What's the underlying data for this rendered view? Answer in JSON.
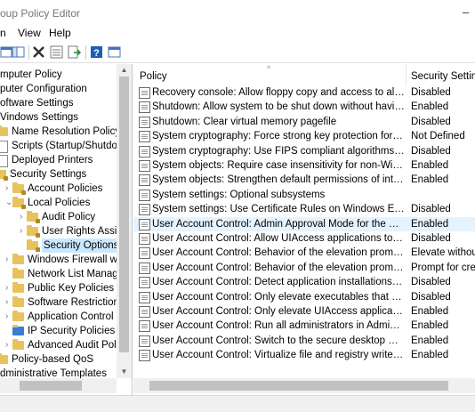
{
  "window": {
    "title": "oup Policy Editor",
    "minimize_glyph": "–"
  },
  "menubar": {
    "items": [
      {
        "label": "n"
      },
      {
        "label": "View"
      },
      {
        "label": "Help"
      }
    ]
  },
  "toolbar": {
    "icons": [
      "back-icon",
      "show-hide-tree-icon",
      "delete-icon",
      "properties-icon",
      "export-icon",
      "help-icon",
      "view-icon"
    ]
  },
  "tree": {
    "items": [
      {
        "label": "mputer Policy",
        "icon": "none",
        "indent": 0
      },
      {
        "label": "puter Configuration",
        "icon": "none",
        "indent": 0
      },
      {
        "label": "oftware Settings",
        "icon": "none",
        "indent": 0
      },
      {
        "label": "Vindows Settings",
        "icon": "none",
        "indent": 0
      },
      {
        "label": "Name Resolution Policy",
        "icon": "folder",
        "indent": 0
      },
      {
        "label": "Scripts (Startup/Shutdown",
        "icon": "doc",
        "indent": 0
      },
      {
        "label": "Deployed Printers",
        "icon": "doc",
        "indent": 0
      },
      {
        "label": "Security Settings",
        "icon": "folder-lock",
        "indent": 0
      },
      {
        "label": "Account Policies",
        "icon": "folder-lock",
        "indent": 1
      },
      {
        "label": "Local Policies",
        "icon": "folder-lock",
        "indent": 1
      },
      {
        "label": "Audit Policy",
        "icon": "folder-lock",
        "indent": 2
      },
      {
        "label": "User Rights Assignr",
        "icon": "folder-lock",
        "indent": 2
      },
      {
        "label": "Security Options",
        "icon": "folder-lock",
        "indent": 2,
        "selected": true
      },
      {
        "label": "Windows Firewall with",
        "icon": "folder",
        "indent": 1
      },
      {
        "label": "Network List Manager I",
        "icon": "folder",
        "indent": 1
      },
      {
        "label": "Public Key Policies",
        "icon": "folder",
        "indent": 1
      },
      {
        "label": "Software Restriction Po",
        "icon": "folder",
        "indent": 1
      },
      {
        "label": "Application Control Po",
        "icon": "folder",
        "indent": 1
      },
      {
        "label": "IP Security Policies on L",
        "icon": "folder",
        "indent": 1
      },
      {
        "label": "Advanced Audit Policy",
        "icon": "folder",
        "indent": 1
      },
      {
        "label": "Policy-based QoS",
        "icon": "folder",
        "indent": 0
      },
      {
        "label": "dministrative Templates",
        "icon": "none",
        "indent": 0
      }
    ]
  },
  "list": {
    "columns": {
      "policy": "Policy",
      "setting": "Security Setting"
    },
    "rows": [
      {
        "policy": "Recovery console: Allow floppy copy and access to all drives...",
        "setting": "Disabled"
      },
      {
        "policy": "Shutdown: Allow system to be shut down without having to...",
        "setting": "Enabled"
      },
      {
        "policy": "Shutdown: Clear virtual memory pagefile",
        "setting": "Disabled"
      },
      {
        "policy": "System cryptography: Force strong key protection for user k...",
        "setting": "Not Defined"
      },
      {
        "policy": "System cryptography: Use FIPS compliant algorithms for en...",
        "setting": "Disabled"
      },
      {
        "policy": "System objects: Require case insensitivity for non-Windows ...",
        "setting": "Enabled"
      },
      {
        "policy": "System objects: Strengthen default permissions of internal s...",
        "setting": "Enabled"
      },
      {
        "policy": "System settings: Optional subsystems",
        "setting": ""
      },
      {
        "policy": "System settings: Use Certificate Rules on Windows Executabl...",
        "setting": "Disabled"
      },
      {
        "policy": "User Account Control: Admin Approval Mode for the Built-i...",
        "setting": "Enabled",
        "selected": true
      },
      {
        "policy": "User Account Control: Allow UIAccess applications to prom...",
        "setting": "Disabled"
      },
      {
        "policy": "User Account Control: Behavior of the elevation prompt for ...",
        "setting": "Elevate without"
      },
      {
        "policy": "User Account Control: Behavior of the elevation prompt for ...",
        "setting": "Prompt for cred"
      },
      {
        "policy": "User Account Control: Detect application installations and p...",
        "setting": "Disabled"
      },
      {
        "policy": "User Account Control: Only elevate executables that are sign...",
        "setting": "Disabled"
      },
      {
        "policy": "User Account Control: Only elevate UIAccess applications th...",
        "setting": "Enabled"
      },
      {
        "policy": "User Account Control: Run all administrators in Admin Appr...",
        "setting": "Enabled"
      },
      {
        "policy": "User Account Control: Switch to the secure desktop when pr...",
        "setting": "Enabled"
      },
      {
        "policy": "User Account Control: Virtualize file and registry write failure...",
        "setting": "Enabled"
      }
    ]
  }
}
